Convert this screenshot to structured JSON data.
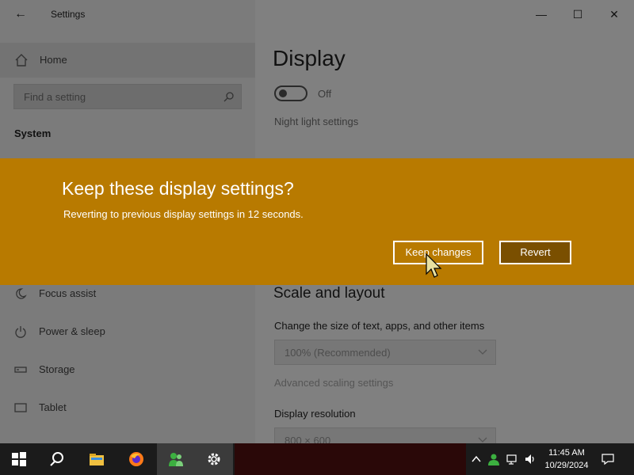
{
  "window": {
    "title": "Settings",
    "back_glyph": "←",
    "minimize_glyph": "—",
    "maximize_glyph": "☐",
    "close_glyph": "✕"
  },
  "sidebar": {
    "home_label": "Home",
    "search_placeholder": "Find a setting",
    "section_title": "System",
    "items": [
      {
        "label": "Focus assist",
        "icon": "moon-icon"
      },
      {
        "label": "Power & sleep",
        "icon": "power-icon"
      },
      {
        "label": "Storage",
        "icon": "storage-icon"
      },
      {
        "label": "Tablet",
        "icon": "tablet-icon"
      }
    ]
  },
  "main": {
    "title": "Display",
    "night_light_toggle": "Off",
    "night_light_link": "Night light settings",
    "scale_title": "Scale and layout",
    "change_size_label": "Change the size of text, apps, and other items",
    "scale_value": "100% (Recommended)",
    "advanced_link": "Advanced scaling settings",
    "resolution_label": "Display resolution",
    "resolution_value": "800 × 600"
  },
  "dialog": {
    "title": "Keep these display settings?",
    "message": "Reverting to previous display settings in 12 seconds.",
    "keep_label": "Keep changes",
    "revert_label": "Revert",
    "color": "#b87a00"
  },
  "taskbar": {
    "time": "11:45 AM",
    "date": "10/29/2024",
    "apps": [
      "windows-start-icon",
      "search-icon",
      "file-explorer-icon",
      "firefox-icon",
      "people-app-icon",
      "settings-icon"
    ]
  }
}
